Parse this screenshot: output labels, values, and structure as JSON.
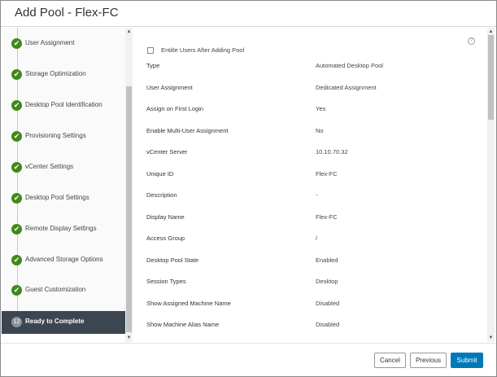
{
  "dialog": {
    "title": "Add Pool - Flex-FC"
  },
  "nav": {
    "steps": [
      {
        "label": "User Assignment",
        "state": "complete"
      },
      {
        "label": "Storage Optimization",
        "state": "complete"
      },
      {
        "label": "Desktop Pool Identification",
        "state": "complete"
      },
      {
        "label": "Provisioning Settings",
        "state": "complete"
      },
      {
        "label": "vCenter Settings",
        "state": "complete"
      },
      {
        "label": "Desktop Pool Settings",
        "state": "complete"
      },
      {
        "label": "Remote Display Settings",
        "state": "complete"
      },
      {
        "label": "Advanced Storage Options",
        "state": "complete"
      },
      {
        "label": "Guest Customization",
        "state": "complete"
      },
      {
        "label": "Ready to Complete",
        "state": "active",
        "number": "12"
      }
    ],
    "complete_color": "#3f8a1a",
    "active_color": "#3b4650"
  },
  "main": {
    "entitle_label": "Entitle Users After Adding Pool",
    "entitle_checked": false,
    "rows": [
      {
        "key": "Type",
        "value": "Automated Desktop Pool"
      },
      {
        "key": "User Assignment",
        "value": "Dedicated Assignment"
      },
      {
        "key": "Assign on First Login",
        "value": "Yes"
      },
      {
        "key": "Enable Multi-User Assignment",
        "value": "No"
      },
      {
        "key": "vCenter Server",
        "value": "10.10.70.32"
      },
      {
        "key": "Unique ID",
        "value": "Flex-FC"
      },
      {
        "key": "Description",
        "value": "-"
      },
      {
        "key": "Display Name",
        "value": "Flex-FC"
      },
      {
        "key": "Access Group",
        "value": "/"
      },
      {
        "key": "Desktop Pool State",
        "value": "Enabled"
      },
      {
        "key": "Session Types",
        "value": "Desktop"
      },
      {
        "key": "Show Assigned Machine Name",
        "value": "Disabled"
      },
      {
        "key": "Show Machine Alias Name",
        "value": "Disabled"
      }
    ]
  },
  "footer": {
    "cancel_label": "Cancel",
    "previous_label": "Previous",
    "submit_label": "Submit",
    "primary_color": "#0079b8"
  }
}
